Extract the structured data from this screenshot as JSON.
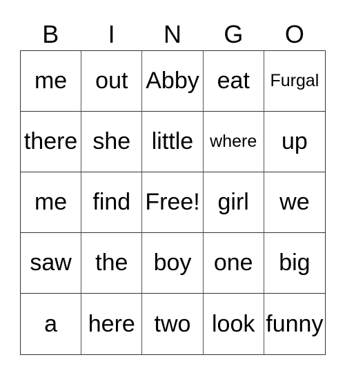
{
  "header": [
    "B",
    "I",
    "N",
    "G",
    "O"
  ],
  "rows": [
    [
      "me",
      "out",
      "Abby",
      "eat",
      "Furgal"
    ],
    [
      "there",
      "she",
      "little",
      "where",
      "up"
    ],
    [
      "me",
      "find",
      "Free!",
      "girl",
      "we"
    ],
    [
      "saw",
      "the",
      "boy",
      "one",
      "big"
    ],
    [
      "a",
      "here",
      "two",
      "look",
      "funny"
    ]
  ]
}
